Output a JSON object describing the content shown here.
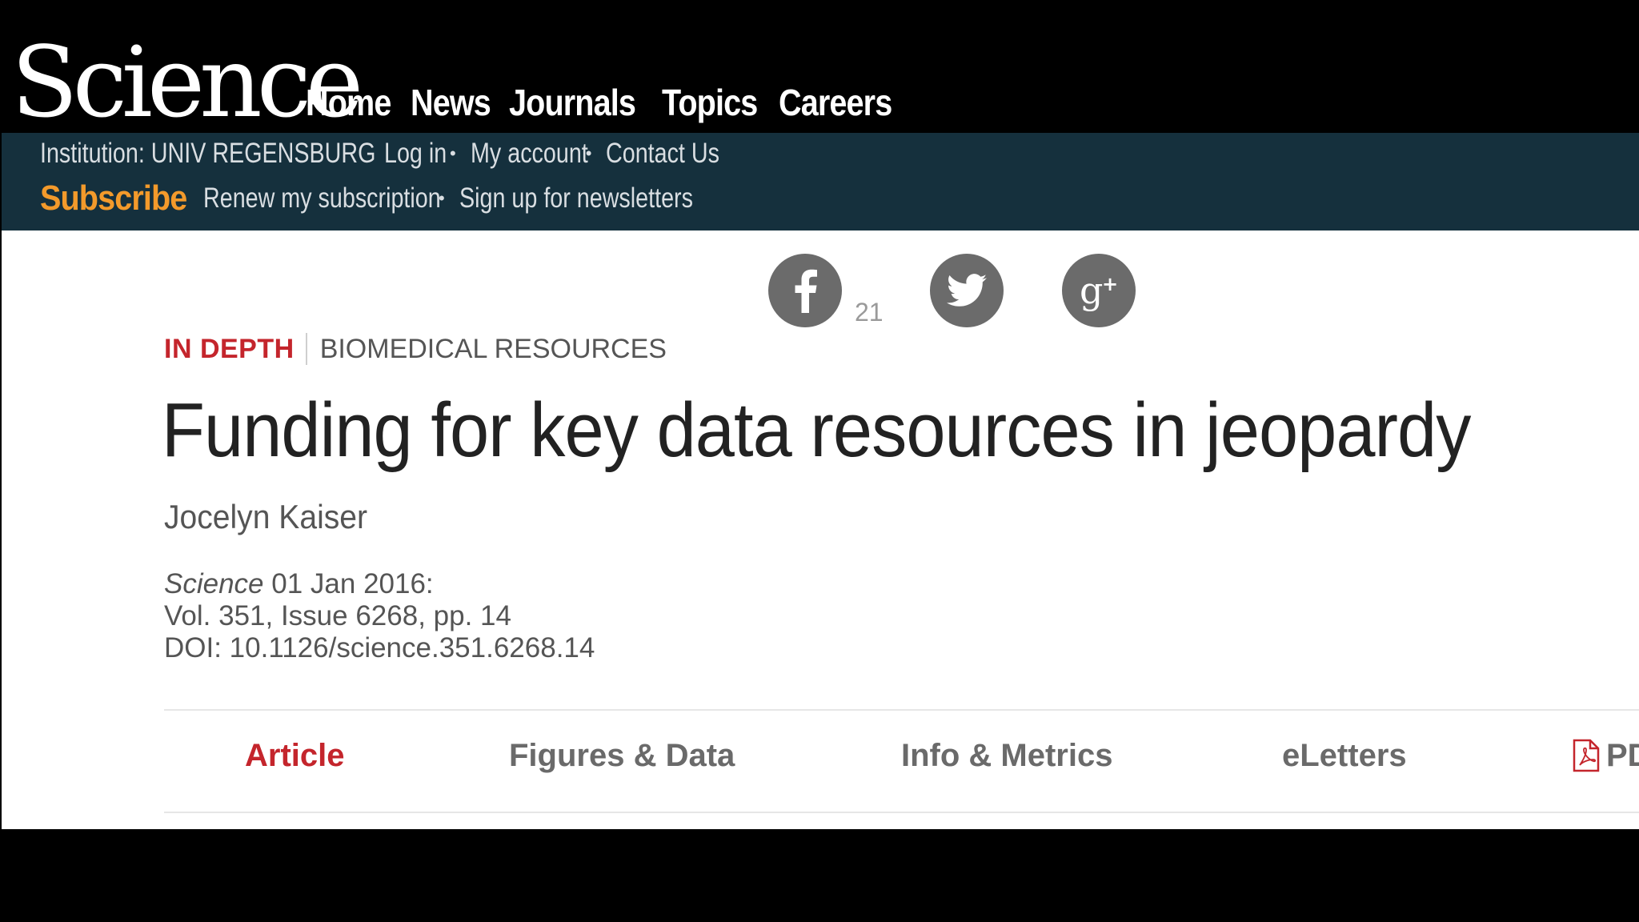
{
  "site": {
    "logo": "Science"
  },
  "main_nav": [
    "Home",
    "News",
    "Journals",
    "Topics",
    "Careers"
  ],
  "utility": {
    "institution": "Institution: UNIV REGENSBURG",
    "links": [
      "Log in",
      "My account",
      "Contact Us"
    ],
    "subscribe": "Subscribe",
    "renew": "Renew my subscription",
    "newsletters": "Sign up for newsletters"
  },
  "share": {
    "facebook_count": "21",
    "icons": [
      "facebook-icon",
      "twitter-icon",
      "google-plus-icon"
    ]
  },
  "article": {
    "section": "IN DEPTH",
    "subsection": "BIOMEDICAL RESOURCES",
    "title": "Funding for key data resources in jeopardy",
    "author": "Jocelyn Kaiser",
    "journal": "Science",
    "date": "01 Jan 2016:",
    "volume": "Vol. 351, Issue 6268, pp. 14",
    "doi": "DOI: 10.1126/science.351.6268.14"
  },
  "tabs": [
    "Article",
    "Figures & Data",
    "Info & Metrics",
    "eLetters",
    "PDF"
  ],
  "colors": {
    "brand_red": "#c4252c",
    "subscribe_orange": "#f39a2b",
    "utility_bg": "#15303d",
    "share_grey": "#6b6b6b"
  }
}
